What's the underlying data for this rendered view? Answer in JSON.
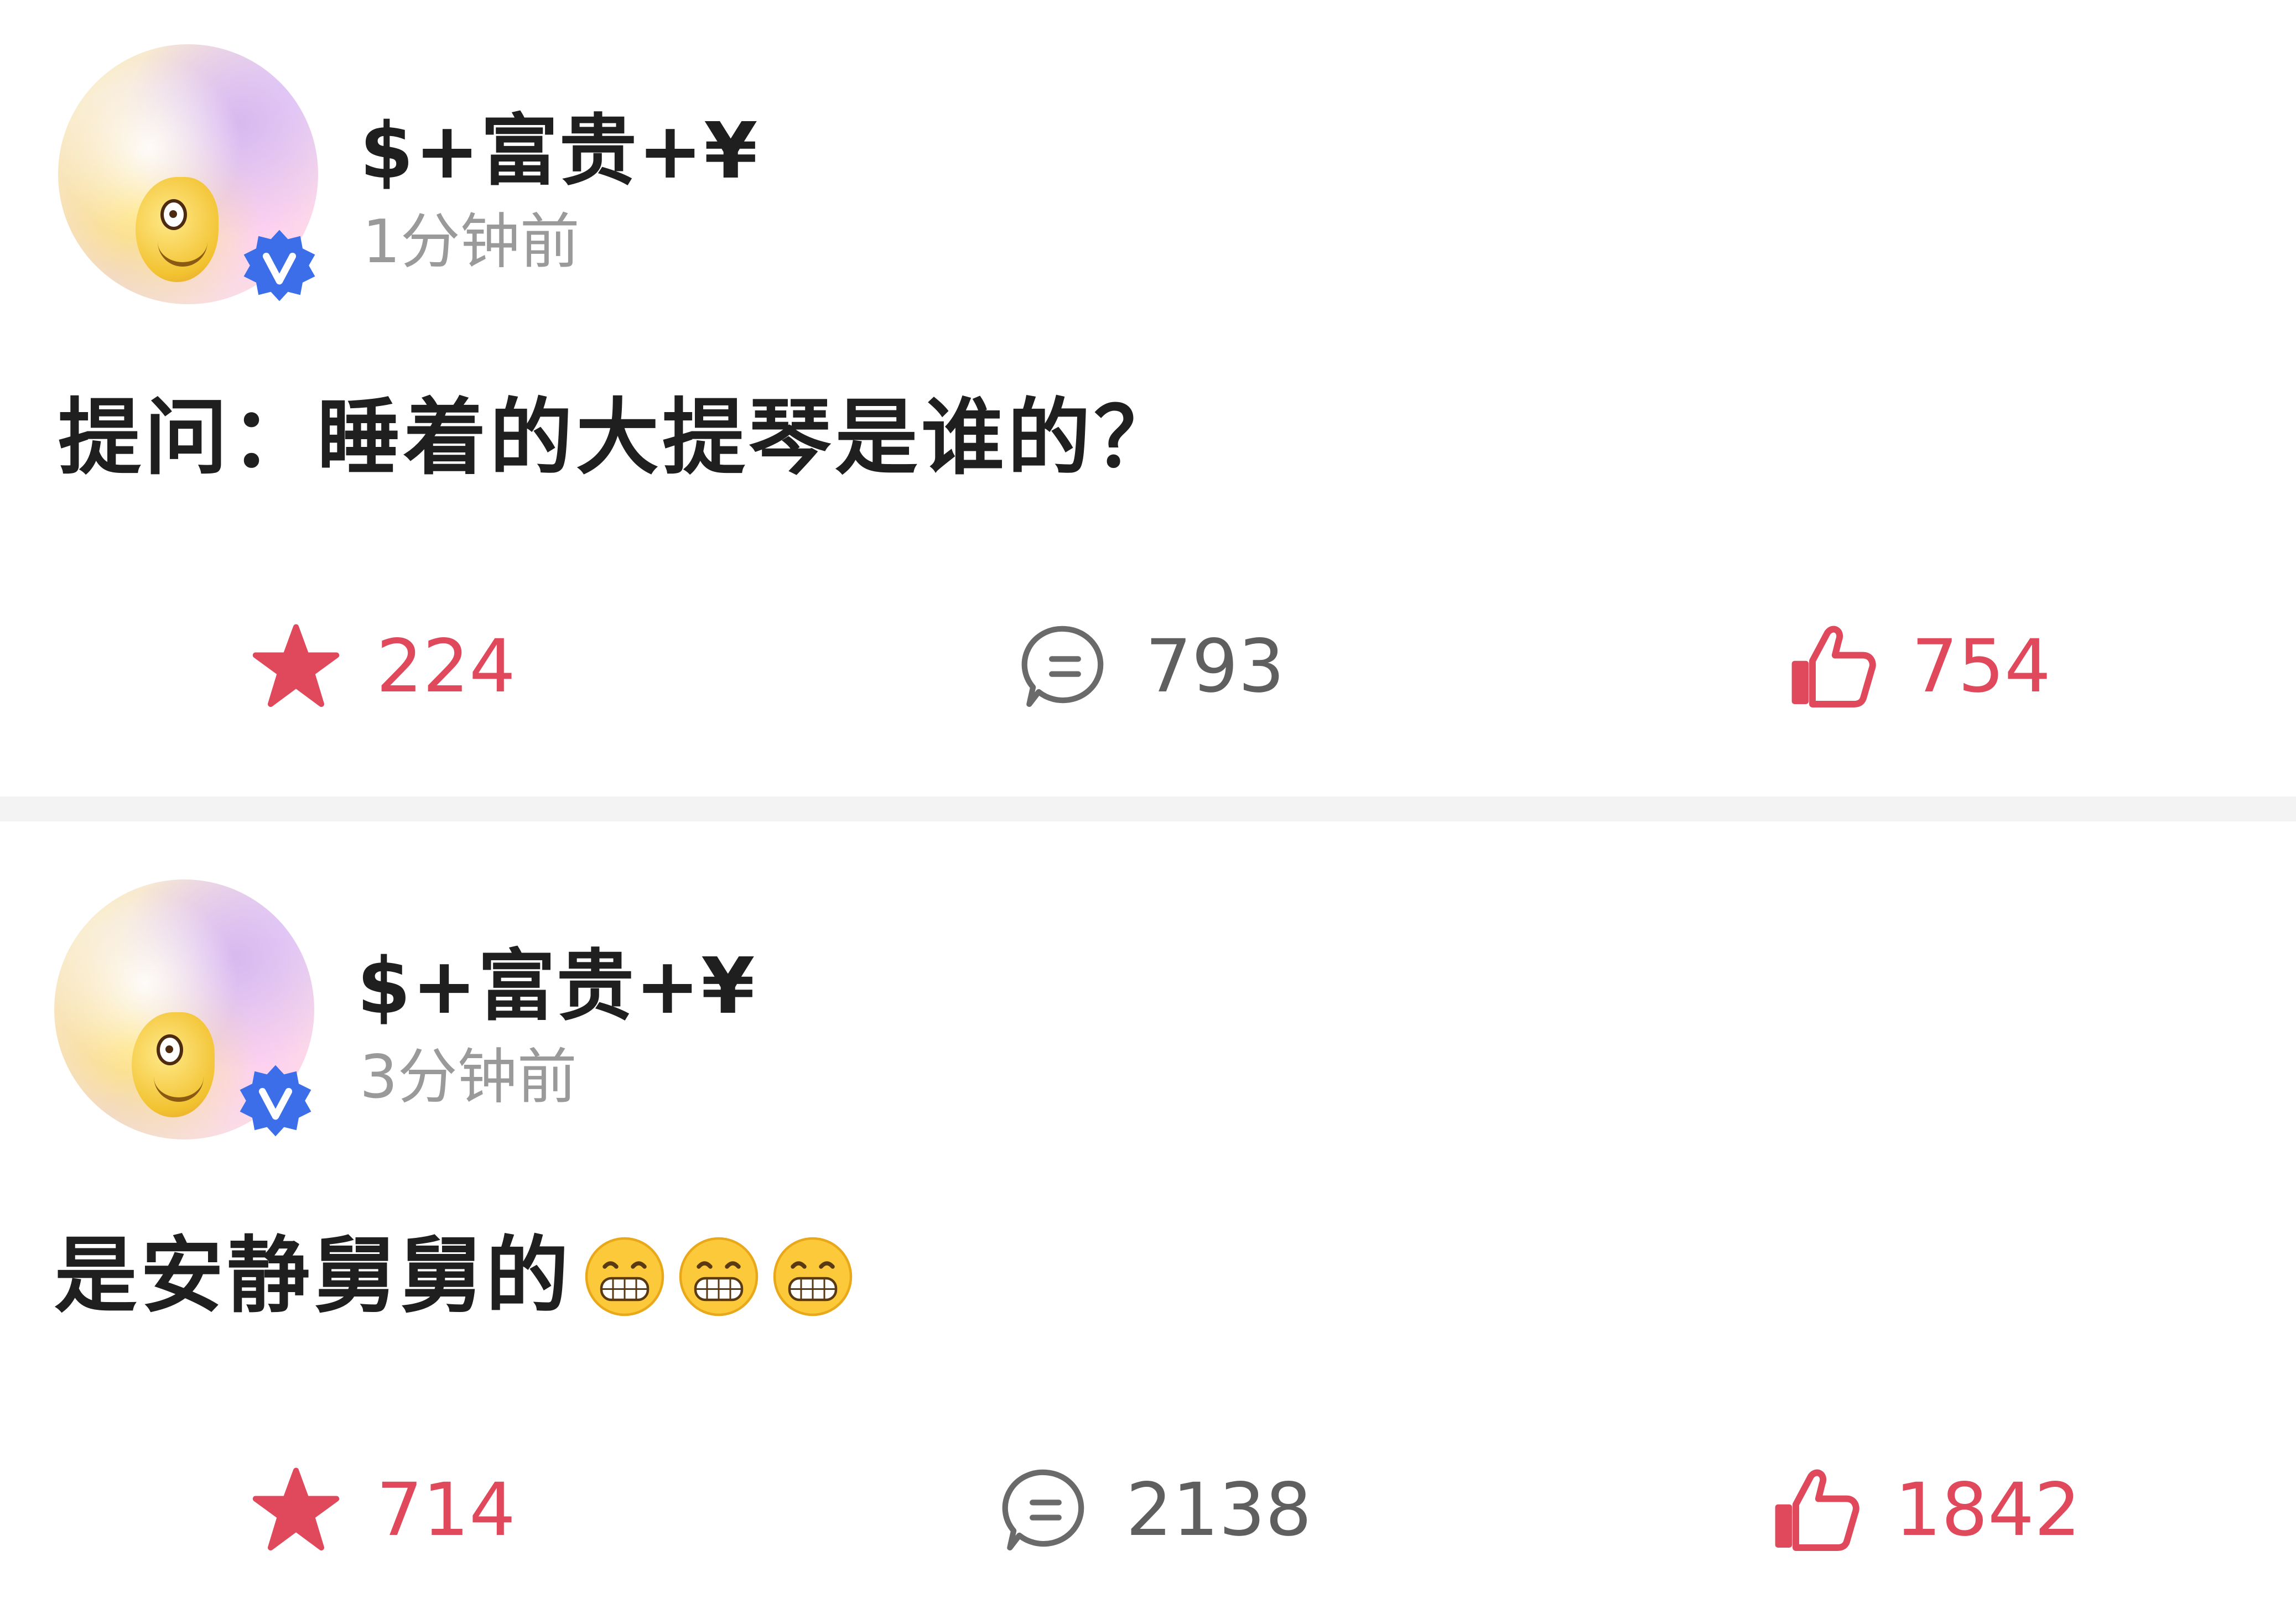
{
  "posts": [
    {
      "username": "$+富贵+¥",
      "time": "1分钟前",
      "content": "提问：睡着的大提琴是谁的？",
      "stats": {
        "favorites": "224",
        "comments": "793",
        "likes": "754"
      }
    },
    {
      "username": "$+富贵+¥",
      "time": "3分钟前",
      "content": "是安静舅舅的",
      "emojis": [
        "grinning-face",
        "grinning-face",
        "grinning-face"
      ],
      "stats": {
        "favorites": "714",
        "comments": "2138",
        "likes": "1842"
      }
    }
  ],
  "icons": {
    "favorite": "star-icon",
    "comment": "comment-bubble-icon",
    "like": "thumbs-up-icon",
    "verified": "verified-badge-icon"
  },
  "colors": {
    "accent_red": "#e0485b",
    "comment_gray": "#5f5f5f",
    "verified_blue": "#3b6ee8",
    "divider": "#f3f3f3"
  }
}
